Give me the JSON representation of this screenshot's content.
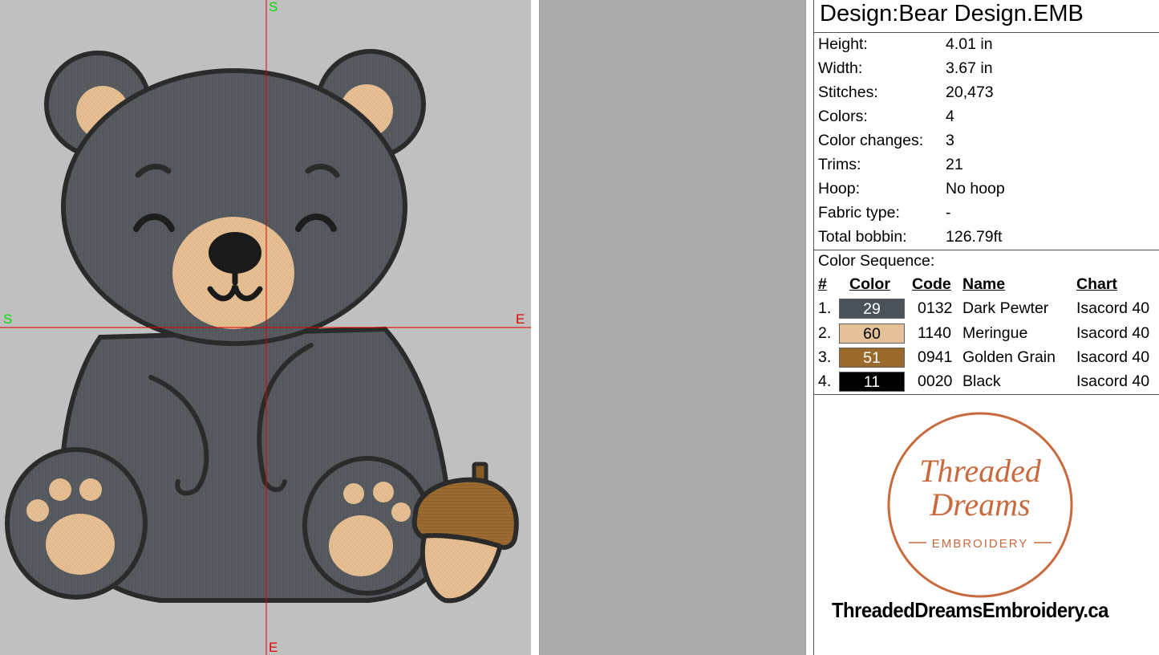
{
  "canvas": {
    "axis_top": "S",
    "axis_left": "S",
    "axis_right": "E",
    "axis_bottom": "E",
    "crosshair_color": "#e00000",
    "axis_letter_start_color": "#00e000",
    "background_color": "#c0c0c0"
  },
  "panel": {
    "title": "Design:Bear Design.EMB",
    "info": [
      {
        "label": "Height:",
        "value": "4.01 in"
      },
      {
        "label": "Width:",
        "value": "3.67 in"
      },
      {
        "label": "Stitches:",
        "value": "20,473"
      },
      {
        "label": "Colors:",
        "value": "4"
      },
      {
        "label": "Color changes:",
        "value": "3"
      },
      {
        "label": "Trims:",
        "value": "21"
      },
      {
        "label": "Hoop:",
        "value": "No hoop"
      },
      {
        "label": "Fabric type:",
        "value": "-"
      },
      {
        "label": "Total bobbin:",
        "value": "126.79ft"
      }
    ],
    "color_sequence_label": "Color Sequence:",
    "headers": {
      "num": "#",
      "color": "Color",
      "code": "Code",
      "name": "Name",
      "chart": "Chart"
    },
    "colors": [
      {
        "num": "1.",
        "swatch_label": "29",
        "swatch_color": "#4a535a",
        "text_color": "#ffffff",
        "code": "0132",
        "name": "Dark Pewter",
        "chart": "Isacord 40"
      },
      {
        "num": "2.",
        "swatch_label": "60",
        "swatch_color": "#e4c199",
        "text_color": "#000000",
        "code": "1140",
        "name": "Meringue",
        "chart": "Isacord 40"
      },
      {
        "num": "3.",
        "swatch_label": "51",
        "swatch_color": "#9a6a2c",
        "text_color": "#ffffff",
        "code": "0941",
        "name": "Golden Grain",
        "chart": "Isacord 40"
      },
      {
        "num": "4.",
        "swatch_label": "11",
        "swatch_color": "#000000",
        "text_color": "#ffffff",
        "code": "0020",
        "name": "Black",
        "chart": "Isacord 40"
      }
    ],
    "logo": {
      "line1": "Threaded",
      "line2": "Dreams",
      "line3": "EMBROIDERY",
      "color": "#c86a3e"
    },
    "website": "ThreadedDreamsEmbroidery.ca"
  }
}
